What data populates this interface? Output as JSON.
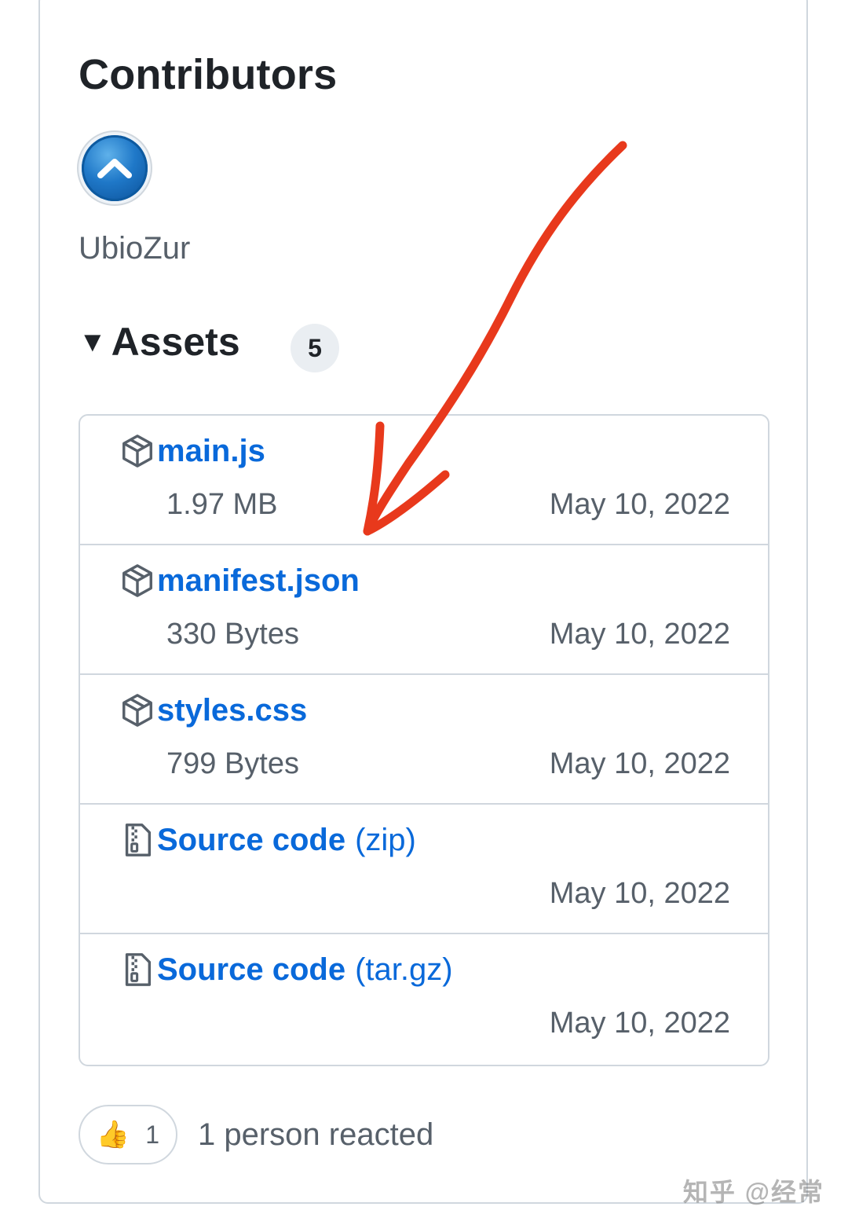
{
  "contributors": {
    "title": "Contributors",
    "people": [
      {
        "name": "UbioZur"
      }
    ]
  },
  "assets": {
    "title": "Assets",
    "count": "5",
    "items": [
      {
        "name": "main.js",
        "suffix": "",
        "size": "1.97 MB",
        "date": "May 10, 2022",
        "icon": "package-icon"
      },
      {
        "name": "manifest.json",
        "suffix": "",
        "size": "330 Bytes",
        "date": "May 10, 2022",
        "icon": "package-icon"
      },
      {
        "name": "styles.css",
        "suffix": "",
        "size": "799 Bytes",
        "date": "May 10, 2022",
        "icon": "package-icon"
      },
      {
        "name": "Source code",
        "suffix": "(zip)",
        "size": "",
        "date": "May 10, 2022",
        "icon": "file-zip-icon"
      },
      {
        "name": "Source code",
        "suffix": "(tar.gz)",
        "size": "",
        "date": "May 10, 2022",
        "icon": "file-zip-icon"
      }
    ]
  },
  "reactions": {
    "emoji": "👍",
    "count": "1",
    "summary": "1 person reacted"
  },
  "watermark": "知乎 @经常",
  "colors": {
    "link": "#0969da",
    "muted": "#57606a",
    "border": "#d0d7de",
    "annotation": "#e8391c"
  }
}
